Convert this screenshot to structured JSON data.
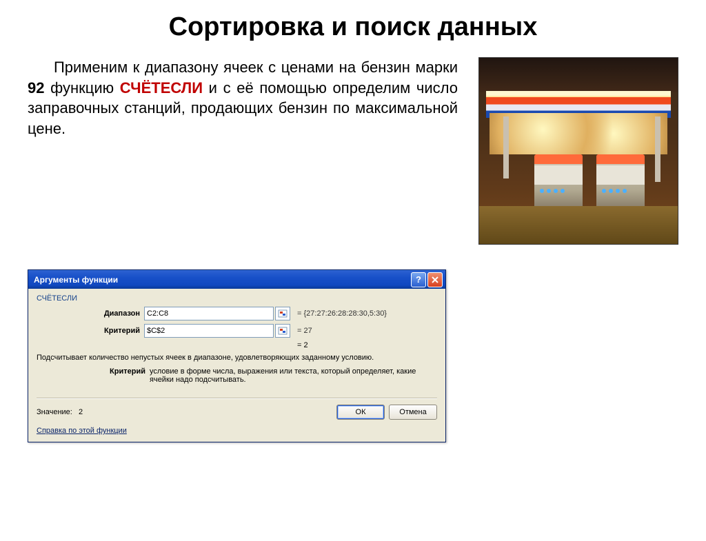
{
  "title": "Сортировка и поиск данных",
  "paragraph": {
    "p1": "Применим к диапазону ячеек с ценами на бензин марки ",
    "bold92": "92",
    "p2": " функцию ",
    "func": "СЧЁТЕСЛИ",
    "p3": " и с её помощью определим число заправочных станций, продающих бензин по максимальной цене."
  },
  "dialog": {
    "title": "Аргументы функции",
    "func_name": "СЧЁТЕСЛИ",
    "args": {
      "range_label": "Диапазон",
      "range_value": "C2:C8",
      "range_preview": "= {27:27:26:28:28:30,5:30}",
      "crit_label": "Критерий",
      "crit_value": "$C$2",
      "crit_preview": "= 27"
    },
    "result_line": "= 2",
    "description": "Подсчитывает количество непустых ячеек в диапазоне, удовлетворяющих заданному условию.",
    "arg_desc_label": "Критерий",
    "arg_desc_text": "условие в форме числа, выражения или текста, который определяет, какие ячейки надо подсчитывать.",
    "value_label": "Значение:",
    "value_result": "2",
    "help_link": "Справка по этой функции",
    "ok": "ОК",
    "cancel": "Отмена"
  }
}
